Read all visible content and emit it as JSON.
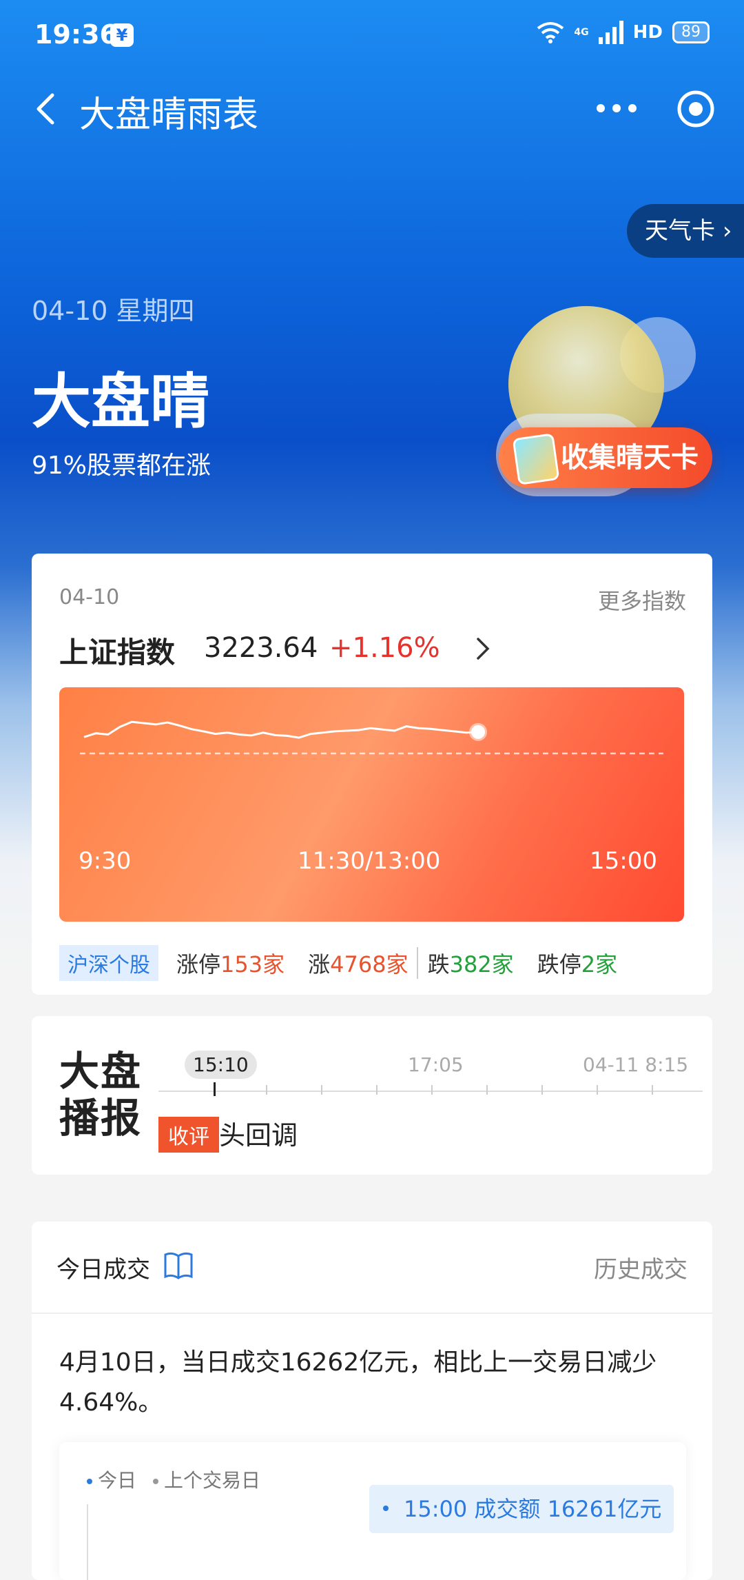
{
  "status": {
    "time": "19:36",
    "yuan_icon": "¥",
    "net": "4G",
    "hd": "HD",
    "battery": "89"
  },
  "header": {
    "title": "大盘晴雨表"
  },
  "hero": {
    "weather_card": "天气卡",
    "date": "04-10 星期四",
    "headline": "大盘晴",
    "subtitle": "91%股票都在涨",
    "collect_button": "收集晴天卡"
  },
  "index_card": {
    "date": "04-10",
    "more": "更多指数",
    "name": "上证指数",
    "value": "3223.64",
    "change": "+1.16%",
    "ticks": [
      "9:30",
      "11:30/13:00",
      "15:00"
    ],
    "market_tag": "沪深个股",
    "stats": {
      "limit_up_label": "涨停",
      "limit_up_value": "153家",
      "up_label": "涨",
      "up_value": "4768家",
      "down_label": "跌",
      "down_value": "382家",
      "limit_down_label": "跌停",
      "limit_down_value": "2家"
    },
    "colors": {
      "up": "#e8522c",
      "down": "#22a13b",
      "index_change": "#e5322d"
    }
  },
  "chart_data": {
    "type": "line",
    "x": [
      "9:30",
      "11:30/13:00",
      "15:00"
    ],
    "series": [
      {
        "values": [
          0.3,
          0.42,
          0.38,
          0.62,
          0.78,
          0.74,
          0.7,
          0.76,
          0.66,
          0.55,
          0.48,
          0.4,
          0.44,
          0.38,
          0.35,
          0.44,
          0.36,
          0.34,
          0.28,
          0.4,
          0.44,
          0.48,
          0.5,
          0.52,
          0.58,
          0.54,
          0.5,
          0.64,
          0.58,
          0.56,
          0.52,
          0.48,
          0.44,
          0.46
        ]
      }
    ],
    "xlabel": "",
    "ylabel": ""
  },
  "broadcast": {
    "logo_line1": "大盘",
    "logo_line2": "播报",
    "time1": "15:10",
    "time2": "17:05",
    "time3": "04-11 8:15",
    "tag": "收评",
    "text": "头回调"
  },
  "volume": {
    "title": "今日成交",
    "history": "历史成交",
    "summary": "4月10日，当日成交16262亿元，相比上一交易日减少4.64%。",
    "legend_today": "今日",
    "legend_prev": "上个交易日",
    "tooltip": "15:00 成交额 16261亿元"
  }
}
